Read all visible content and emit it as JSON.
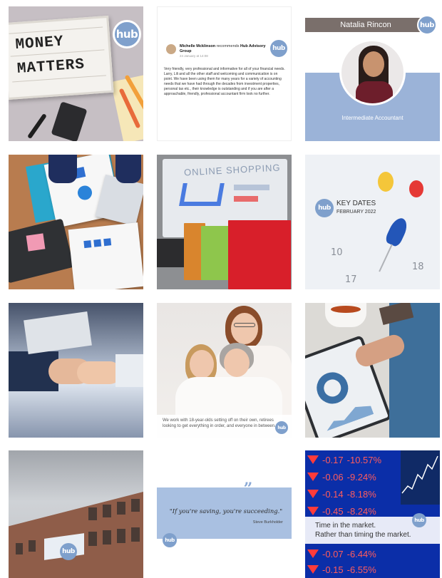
{
  "brand": {
    "logo_text": "hub",
    "accent": "#7fa0cc"
  },
  "tiles": [
    {
      "id": "money-matters",
      "line1": "MONEY",
      "line2": "MATTERS"
    },
    {
      "id": "review",
      "reviewer": "Michelle Mcklinson",
      "action": "recommends",
      "business": "Hub Advisory Group",
      "date": "24 January at 14:08",
      "body": "Very friendly, very professional and informative for all of your financial needs. Larry, Lili and all the other staff and welcoming and communication is on point. We have been using them for many years for a variety of accounting needs that we have had through the decades from investment properties, personal tax etc., their knowledge is outstanding and if you are after a approachable, friendly, professional accountant firm look no further."
    },
    {
      "id": "team-member",
      "name": "Natalia Rincon",
      "role": "Intermediate Accountant"
    },
    {
      "id": "workspace"
    },
    {
      "id": "online-shopping",
      "screen_text": "ONLINE SHOPPING"
    },
    {
      "id": "key-dates",
      "title": "KEY DATES",
      "subtitle": "FEBRUARY 2022",
      "days": [
        "10",
        "17",
        "18"
      ]
    },
    {
      "id": "handshake"
    },
    {
      "id": "family",
      "caption": "We work with 18-year-olds setting off on their own, retirees looking to get everything in order, and everyone in between."
    },
    {
      "id": "tablet-chart"
    },
    {
      "id": "office-building"
    },
    {
      "id": "quote",
      "mark": "”",
      "text": "\"If you're saving, you're succeeding.\"",
      "author": "Steve Burkholder"
    },
    {
      "id": "stock-market",
      "rows": [
        {
          "a": "-0.17",
          "b": "-10.57%"
        },
        {
          "a": "-0.06",
          "b": "-9.24%"
        },
        {
          "a": "-0.14",
          "b": "-8.18%"
        },
        {
          "a": "-0.45",
          "b": "-8.24%"
        }
      ],
      "bottom_rows": [
        {
          "a": "-0.07",
          "b": "-6.44%"
        },
        {
          "a": "-0.15",
          "b": "-6.55%"
        }
      ],
      "caption_line1": "Time in the market.",
      "caption_line2": "Rather than timing the market."
    }
  ]
}
